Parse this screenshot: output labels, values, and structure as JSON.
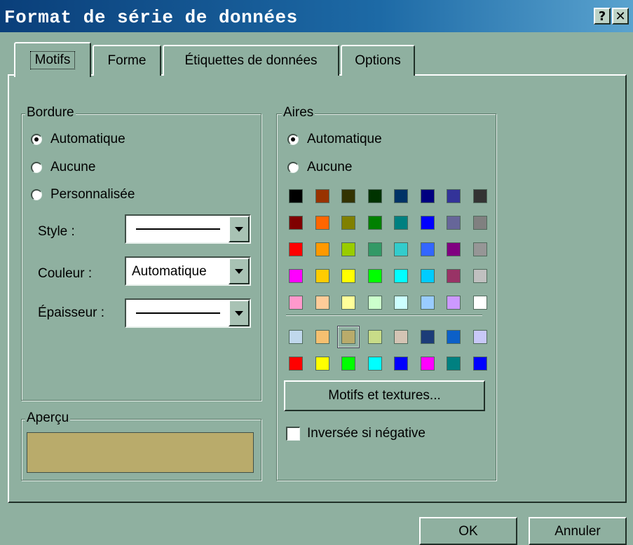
{
  "window": {
    "title": "Format de série de données",
    "help_label": "?",
    "close_label": "✕"
  },
  "tabs": [
    {
      "label": "Motifs",
      "active": true
    },
    {
      "label": "Forme",
      "active": false
    },
    {
      "label": "Étiquettes de données",
      "active": false
    },
    {
      "label": "Options",
      "active": false
    }
  ],
  "border": {
    "group_label": "Bordure",
    "options": [
      {
        "label": "Automatique",
        "checked": true
      },
      {
        "label": "Aucune",
        "checked": false
      },
      {
        "label": "Personnalisée",
        "checked": false
      }
    ],
    "style_label": "Style :",
    "color_label": "Couleur :",
    "color_value": "Automatique",
    "weight_label": "Épaisseur :"
  },
  "preview": {
    "group_label": "Aperçu",
    "fill_color": "#b9ab6b"
  },
  "area": {
    "group_label": "Aires",
    "options": [
      {
        "label": "Automatique",
        "checked": true
      },
      {
        "label": "Aucune",
        "checked": false
      }
    ],
    "palette": [
      [
        "#000000",
        "#993300",
        "#333300",
        "#003300",
        "#003366",
        "#000080",
        "#333399",
        "#333333"
      ],
      [
        "#800000",
        "#ff6600",
        "#808000",
        "#008000",
        "#008080",
        "#0000ff",
        "#666699",
        "#808080"
      ],
      [
        "#ff0000",
        "#ff9900",
        "#99cc00",
        "#339966",
        "#33cccc",
        "#3366ff",
        "#800080",
        "#969696"
      ],
      [
        "#ff00ff",
        "#ffcc00",
        "#ffff00",
        "#00ff00",
        "#00ffff",
        "#00ccff",
        "#993366",
        "#c0c0c0"
      ],
      [
        "#ff99cc",
        "#ffcc99",
        "#ffff99",
        "#ccffcc",
        "#ccffff",
        "#99ccff",
        "#cc99ff",
        "#ffffff"
      ]
    ],
    "palette_extra": [
      [
        "#c0d8ec",
        "#f5c070",
        "#b9ab6b",
        "#c8dc88",
        "#d4c4b4",
        "#1c3c78",
        "#0c60c8",
        "#c8c8f8"
      ],
      [
        "#ff0000",
        "#ffff00",
        "#00ff00",
        "#00ffff",
        "#0000ff",
        "#ff00ff",
        "#008080",
        "#0000ff"
      ]
    ],
    "selected_extra": [
      0,
      2
    ],
    "fill_effects_label": "Motifs et textures...",
    "invert_label": "Inversée si négative"
  },
  "footer": {
    "ok_label": "OK",
    "cancel_label": "Annuler"
  }
}
